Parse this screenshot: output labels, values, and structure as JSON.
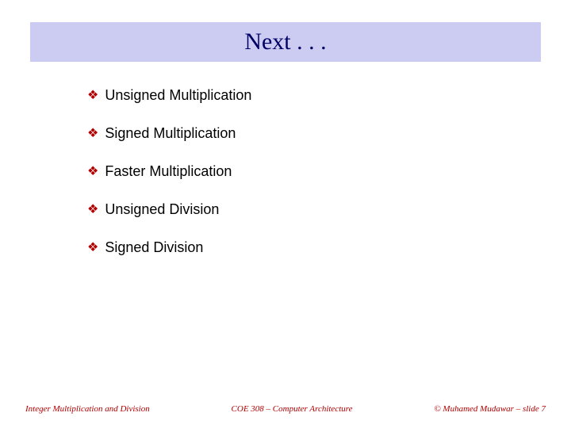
{
  "title": "Next . . .",
  "bullets": [
    {
      "label": "Unsigned Multiplication"
    },
    {
      "label": "Signed Multiplication"
    },
    {
      "label": "Faster Multiplication"
    },
    {
      "label": "Unsigned Division"
    },
    {
      "label": "Signed Division"
    }
  ],
  "footer": {
    "left": "Integer Multiplication and Division",
    "center": "COE 308 – Computer Architecture",
    "right": "© Muhamed Mudawar – slide 7"
  },
  "bullet_glyph": "❖"
}
